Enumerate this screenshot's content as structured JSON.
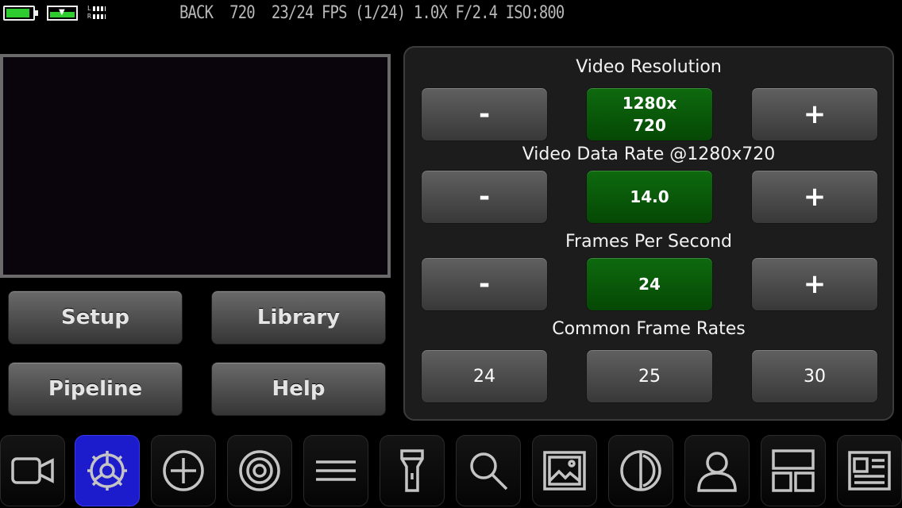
{
  "status": {
    "text": "BACK  720  23/24 FPS (1/24) 1.0X F/2.4 ISO:800",
    "audio_l": "L",
    "audio_r": "R",
    "battery_color": "#2ecc2e"
  },
  "left_buttons": {
    "setup": "Setup",
    "library": "Library",
    "pipeline": "Pipeline",
    "help": "Help"
  },
  "settings": {
    "resolution": {
      "title": "Video Resolution",
      "minus": "-",
      "value_line1": "1280x",
      "value_line2": "720",
      "plus": "+"
    },
    "data_rate": {
      "title": "Video Data Rate @1280x720",
      "minus": "-",
      "value": "14.0",
      "plus": "+"
    },
    "fps": {
      "title": "Frames Per Second",
      "minus": "-",
      "value": "24",
      "plus": "+"
    },
    "common_rates": {
      "title": "Common Frame Rates",
      "options": [
        "24",
        "25",
        "30"
      ]
    }
  },
  "toolbar": {
    "active_color": "#1c1ccc",
    "items": [
      "video-camera-icon",
      "gear-icon",
      "crosshair-icon",
      "target-icon",
      "menu-lines-icon",
      "flashlight-icon",
      "search-icon",
      "image-icon",
      "contrast-icon",
      "person-icon",
      "layout-icon",
      "news-icon"
    ]
  }
}
